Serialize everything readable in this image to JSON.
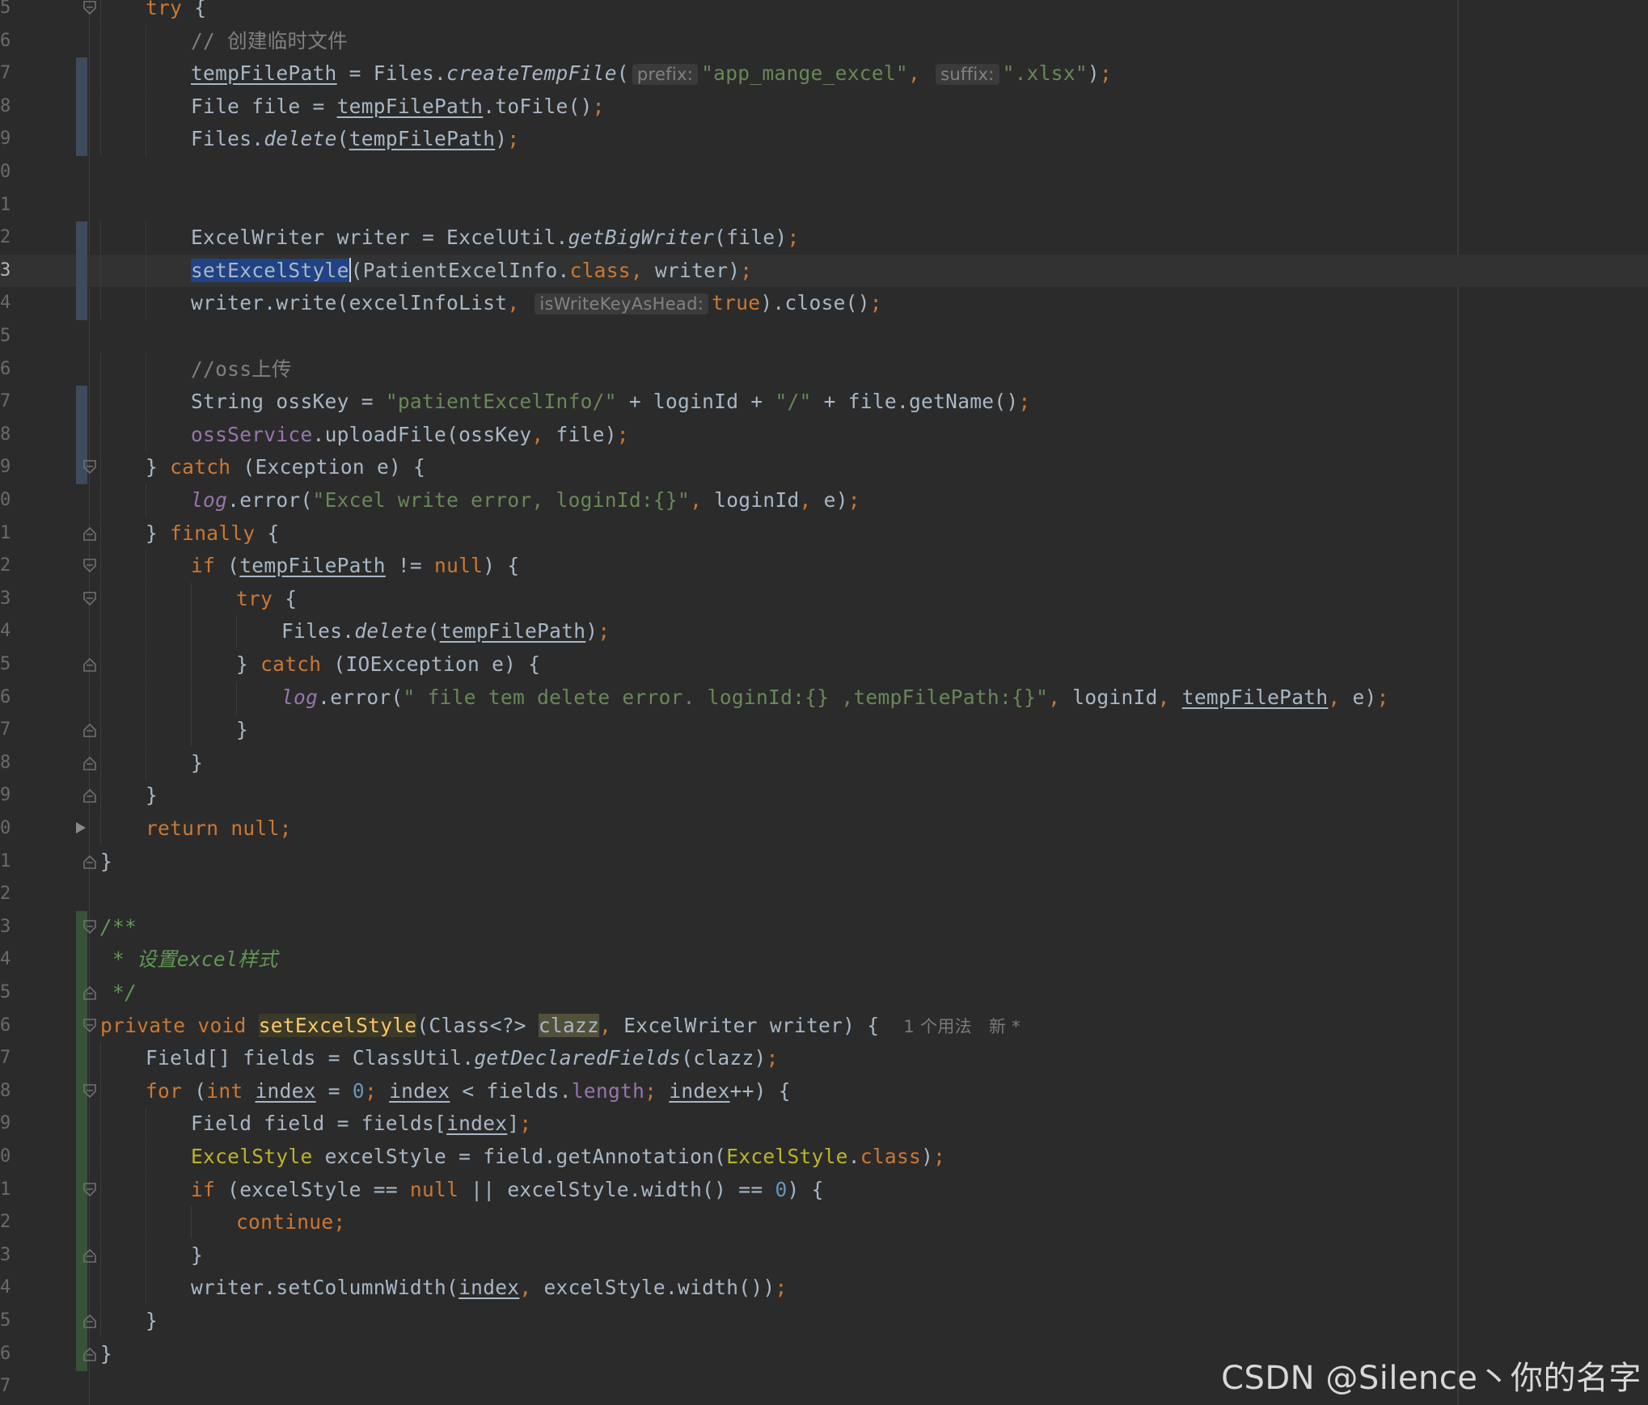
{
  "editor": {
    "lines": [
      {
        "no": "5",
        "fold": "open",
        "tokens": [
          {
            "t": "try",
            "c": "kw"
          },
          {
            "t": " {",
            "c": "plain"
          }
        ]
      },
      {
        "no": "6",
        "tokens": [
          {
            "t": "// 创建临时文件",
            "c": "comment"
          }
        ]
      },
      {
        "no": "7",
        "tokens": [
          {
            "t": "tempFilePath",
            "c": "var"
          },
          {
            "t": " = Files.",
            "c": "plain"
          },
          {
            "t": "createTempFile",
            "c": "static"
          },
          {
            "t": "(",
            "c": "plain"
          },
          {
            "t": "prefix:",
            "c": "hint"
          },
          {
            "t": "\"app_mange_excel\"",
            "c": "str"
          },
          {
            "t": ", ",
            "c": "punct"
          },
          {
            "t": "suffix:",
            "c": "hint"
          },
          {
            "t": "\".xlsx\"",
            "c": "str"
          },
          {
            "t": ")",
            "c": "plain"
          },
          {
            "t": ";",
            "c": "punct"
          }
        ]
      },
      {
        "no": "8",
        "tokens": [
          {
            "t": "File file = ",
            "c": "plain"
          },
          {
            "t": "tempFilePath",
            "c": "var"
          },
          {
            "t": ".toFile()",
            "c": "plain"
          },
          {
            "t": ";",
            "c": "punct"
          }
        ]
      },
      {
        "no": "9",
        "tokens": [
          {
            "t": "Files.",
            "c": "plain"
          },
          {
            "t": "delete",
            "c": "static"
          },
          {
            "t": "(",
            "c": "plain"
          },
          {
            "t": "tempFilePath",
            "c": "var"
          },
          {
            "t": ")",
            "c": "plain"
          },
          {
            "t": ";",
            "c": "punct"
          }
        ]
      },
      {
        "no": "0",
        "tokens": []
      },
      {
        "no": "1",
        "tokens": []
      },
      {
        "no": "2",
        "tokens": [
          {
            "t": "ExcelWriter writer = ExcelUtil.",
            "c": "plain"
          },
          {
            "t": "getBigWriter",
            "c": "static"
          },
          {
            "t": "(file)",
            "c": "plain"
          },
          {
            "t": ";",
            "c": "punct"
          }
        ]
      },
      {
        "no": "3",
        "current": true,
        "tokens": [
          {
            "t": "setExcelStyle",
            "c": "selected"
          },
          {
            "t": "",
            "c": "caret"
          },
          {
            "t": "(PatientExcelInfo.",
            "c": "plain"
          },
          {
            "t": "class",
            "c": "kw"
          },
          {
            "t": ", ",
            "c": "punct"
          },
          {
            "t": "writer)",
            "c": "plain"
          },
          {
            "t": ";",
            "c": "punct"
          }
        ]
      },
      {
        "no": "4",
        "tokens": [
          {
            "t": "writer.write(excelInfoList",
            "c": "plain"
          },
          {
            "t": ", ",
            "c": "punct"
          },
          {
            "t": "isWriteKeyAsHead:",
            "c": "hint"
          },
          {
            "t": "true",
            "c": "kw"
          },
          {
            "t": ").close()",
            "c": "plain"
          },
          {
            "t": ";",
            "c": "punct"
          }
        ]
      },
      {
        "no": "5",
        "tokens": []
      },
      {
        "no": "6",
        "tokens": [
          {
            "t": "//oss上传",
            "c": "comment"
          }
        ]
      },
      {
        "no": "7",
        "tokens": [
          {
            "t": "String ossKey = ",
            "c": "plain"
          },
          {
            "t": "\"patientExcelInfo/\"",
            "c": "str"
          },
          {
            "t": " + loginId + ",
            "c": "plain"
          },
          {
            "t": "\"/\"",
            "c": "str"
          },
          {
            "t": " + file.getName()",
            "c": "plain"
          },
          {
            "t": ";",
            "c": "punct"
          }
        ]
      },
      {
        "no": "8",
        "tokens": [
          {
            "t": "ossService",
            "c": "field"
          },
          {
            "t": ".uploadFile(ossKey",
            "c": "plain"
          },
          {
            "t": ", ",
            "c": "punct"
          },
          {
            "t": "file)",
            "c": "plain"
          },
          {
            "t": ";",
            "c": "punct"
          }
        ]
      },
      {
        "no": "9",
        "fold": "open",
        "tokens": [
          {
            "t": "} ",
            "c": "plain"
          },
          {
            "t": "catch",
            "c": "kw"
          },
          {
            "t": " (Exception e) {",
            "c": "plain"
          }
        ]
      },
      {
        "no": "0",
        "tokens": [
          {
            "t": "log",
            "c": "fielditalic"
          },
          {
            "t": ".error(",
            "c": "plain"
          },
          {
            "t": "\"Excel write error, loginId:{}\"",
            "c": "str"
          },
          {
            "t": ", ",
            "c": "punct"
          },
          {
            "t": "loginId",
            "c": "plain"
          },
          {
            "t": ", ",
            "c": "punct"
          },
          {
            "t": "e)",
            "c": "plain"
          },
          {
            "t": ";",
            "c": "punct"
          }
        ]
      },
      {
        "no": "1",
        "fold": "close",
        "tokens": [
          {
            "t": "} ",
            "c": "plain"
          },
          {
            "t": "finally",
            "c": "kw"
          },
          {
            "t": " {",
            "c": "plain"
          }
        ]
      },
      {
        "no": "2",
        "fold": "open",
        "tokens": [
          {
            "t": "if",
            "c": "kw"
          },
          {
            "t": " (",
            "c": "plain"
          },
          {
            "t": "tempFilePath",
            "c": "var"
          },
          {
            "t": " != ",
            "c": "plain"
          },
          {
            "t": "null",
            "c": "kw"
          },
          {
            "t": ") {",
            "c": "plain"
          }
        ]
      },
      {
        "no": "3",
        "fold": "open",
        "tokens": [
          {
            "t": "try",
            "c": "kw"
          },
          {
            "t": " {",
            "c": "plain"
          }
        ]
      },
      {
        "no": "4",
        "tokens": [
          {
            "t": "Files.",
            "c": "plain"
          },
          {
            "t": "delete",
            "c": "static"
          },
          {
            "t": "(",
            "c": "plain"
          },
          {
            "t": "tempFilePath",
            "c": "var"
          },
          {
            "t": ")",
            "c": "plain"
          },
          {
            "t": ";",
            "c": "punct"
          }
        ]
      },
      {
        "no": "5",
        "fold": "close",
        "tokens": [
          {
            "t": "} ",
            "c": "plain"
          },
          {
            "t": "catch",
            "c": "kw"
          },
          {
            "t": " (IOException e) {",
            "c": "plain"
          }
        ]
      },
      {
        "no": "6",
        "tokens": [
          {
            "t": "log",
            "c": "fielditalic"
          },
          {
            "t": ".error(",
            "c": "plain"
          },
          {
            "t": "\" file tem delete error. loginId:{} ,tempFilePath:{}\"",
            "c": "str"
          },
          {
            "t": ", ",
            "c": "punct"
          },
          {
            "t": "loginId",
            "c": "plain"
          },
          {
            "t": ", ",
            "c": "punct"
          },
          {
            "t": "tempFilePath",
            "c": "var"
          },
          {
            "t": ", ",
            "c": "punct"
          },
          {
            "t": "e)",
            "c": "plain"
          },
          {
            "t": ";",
            "c": "punct"
          }
        ]
      },
      {
        "no": "7",
        "fold": "close",
        "tokens": [
          {
            "t": "}",
            "c": "plain"
          }
        ]
      },
      {
        "no": "8",
        "fold": "close",
        "tokens": [
          {
            "t": "}",
            "c": "plain"
          }
        ]
      },
      {
        "no": "9",
        "fold": "close",
        "tokens": [
          {
            "t": "}",
            "c": "plain"
          }
        ]
      },
      {
        "no": "0",
        "arrow": true,
        "tokens": [
          {
            "t": "return",
            "c": "kw"
          },
          {
            "t": " ",
            "c": "plain"
          },
          {
            "t": "null",
            "c": "kw"
          },
          {
            "t": ";",
            "c": "punct"
          }
        ]
      },
      {
        "no": "1",
        "fold": "close",
        "tokens": [
          {
            "t": "}",
            "c": "plain"
          }
        ]
      },
      {
        "no": "2",
        "tokens": []
      },
      {
        "no": "3",
        "fold": "open",
        "tokens": [
          {
            "t": "/**",
            "c": "doc"
          }
        ]
      },
      {
        "no": "4",
        "tokens": [
          {
            "t": " * 设置excel样式",
            "c": "doc"
          }
        ]
      },
      {
        "no": "5",
        "fold": "close",
        "tokens": [
          {
            "t": " */",
            "c": "doc"
          }
        ]
      },
      {
        "no": "6",
        "fold": "open",
        "tokens": [
          {
            "t": "private",
            "c": "kw"
          },
          {
            "t": " ",
            "c": "plain"
          },
          {
            "t": "void",
            "c": "kw"
          },
          {
            "t": " ",
            "c": "plain"
          },
          {
            "t": "setExcelStyle",
            "c": "methodhl"
          },
          {
            "t": "(Class<?> ",
            "c": "plain"
          },
          {
            "t": "clazz",
            "c": "highlight2"
          },
          {
            "t": ", ",
            "c": "punct"
          },
          {
            "t": "ExcelWriter writer) {  ",
            "c": "plain"
          },
          {
            "t": "1 个用法   新 *",
            "c": "inlay"
          }
        ]
      },
      {
        "no": "7",
        "tokens": [
          {
            "t": "Field[] fields = ClassUtil.",
            "c": "plain"
          },
          {
            "t": "getDeclaredFields",
            "c": "static"
          },
          {
            "t": "(clazz)",
            "c": "plain"
          },
          {
            "t": ";",
            "c": "punct"
          }
        ]
      },
      {
        "no": "8",
        "fold": "open",
        "tokens": [
          {
            "t": "for",
            "c": "kw"
          },
          {
            "t": " (",
            "c": "plain"
          },
          {
            "t": "int",
            "c": "kw"
          },
          {
            "t": " ",
            "c": "plain"
          },
          {
            "t": "index",
            "c": "var"
          },
          {
            "t": " = ",
            "c": "plain"
          },
          {
            "t": "0",
            "c": "num"
          },
          {
            "t": "; ",
            "c": "punct"
          },
          {
            "t": "index",
            "c": "var"
          },
          {
            "t": " < fields.",
            "c": "plain"
          },
          {
            "t": "length",
            "c": "field"
          },
          {
            "t": "; ",
            "c": "punct"
          },
          {
            "t": "index",
            "c": "var"
          },
          {
            "t": "++) {",
            "c": "plain"
          }
        ]
      },
      {
        "no": "9",
        "tokens": [
          {
            "t": "Field field = fields[",
            "c": "plain"
          },
          {
            "t": "index",
            "c": "var"
          },
          {
            "t": "]",
            "c": "plain"
          },
          {
            "t": ";",
            "c": "punct"
          }
        ]
      },
      {
        "no": "0",
        "tokens": [
          {
            "t": "ExcelStyle",
            "c": "annot"
          },
          {
            "t": " excelStyle = field.getAnnotation(",
            "c": "plain"
          },
          {
            "t": "ExcelStyle",
            "c": "annot"
          },
          {
            "t": ".",
            "c": "plain"
          },
          {
            "t": "class",
            "c": "kw"
          },
          {
            "t": ")",
            "c": "plain"
          },
          {
            "t": ";",
            "c": "punct"
          }
        ]
      },
      {
        "no": "1",
        "fold": "open",
        "tokens": [
          {
            "t": "if",
            "c": "kw"
          },
          {
            "t": " (excelStyle == ",
            "c": "plain"
          },
          {
            "t": "null",
            "c": "kw"
          },
          {
            "t": " || excelStyle.width() == ",
            "c": "plain"
          },
          {
            "t": "0",
            "c": "num"
          },
          {
            "t": ") {",
            "c": "plain"
          }
        ]
      },
      {
        "no": "2",
        "tokens": [
          {
            "t": "continue",
            "c": "kw"
          },
          {
            "t": ";",
            "c": "punct"
          }
        ]
      },
      {
        "no": "3",
        "fold": "close",
        "tokens": [
          {
            "t": "}",
            "c": "plain"
          }
        ]
      },
      {
        "no": "4",
        "tokens": [
          {
            "t": "writer.setColumnWidth(",
            "c": "plain"
          },
          {
            "t": "index",
            "c": "var"
          },
          {
            "t": ", ",
            "c": "punct"
          },
          {
            "t": "excelStyle.width())",
            "c": "plain"
          },
          {
            "t": ";",
            "c": "punct"
          }
        ]
      },
      {
        "no": "5",
        "fold": "close",
        "tokens": [
          {
            "t": "}",
            "c": "plain"
          }
        ]
      },
      {
        "no": "6",
        "fold": "close",
        "tokens": [
          {
            "t": "}",
            "c": "plain"
          }
        ]
      },
      {
        "no": "7",
        "tokens": []
      }
    ]
  },
  "watermark": "CSDN @Silence丶你的名字",
  "colors": {
    "background": "#2b2b2b",
    "keyword": "#cc7832",
    "string": "#6a8759",
    "number": "#6897bb",
    "comment": "#808080",
    "doc_comment": "#629755",
    "field": "#9876aa",
    "method_decl": "#ffc66d",
    "annotation": "#bbb529",
    "selection": "#214283"
  },
  "icons": [
    "fold-open-icon",
    "fold-close-icon",
    "breakpoint-arrow-icon"
  ]
}
